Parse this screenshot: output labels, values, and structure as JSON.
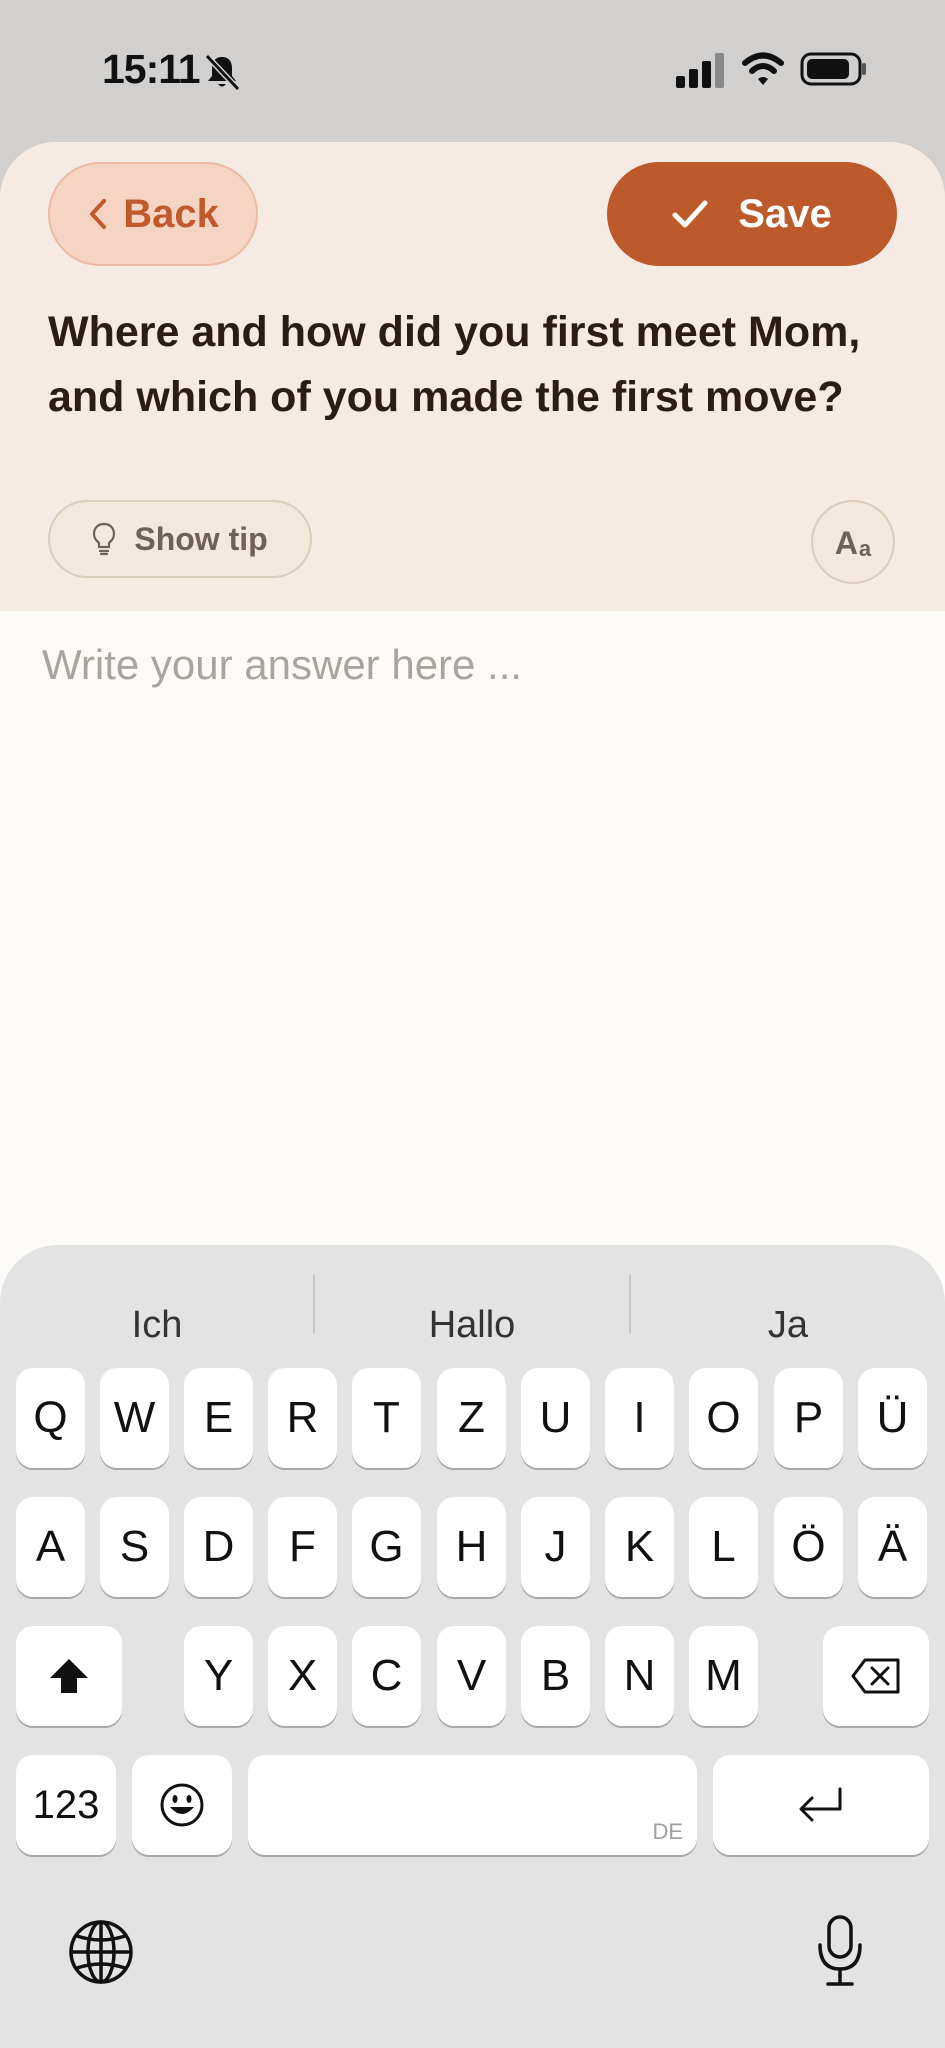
{
  "status_bar": {
    "time": "15:11",
    "icons": [
      "silent-bell-icon",
      "cellular-signal-icon",
      "wifi-icon",
      "battery-icon"
    ]
  },
  "header": {
    "back_label": "Back",
    "save_label": "Save",
    "question": "Where and how did you first meet Mom, and which of you made the first move?",
    "tip_label": "Show tip",
    "font_size_big": "A",
    "font_size_small": "a"
  },
  "answer": {
    "placeholder": "Write your answer here ...",
    "value": ""
  },
  "keyboard": {
    "suggestions": [
      "Ich",
      "Hallo",
      "Ja"
    ],
    "row1": [
      "Q",
      "W",
      "E",
      "R",
      "T",
      "Z",
      "U",
      "I",
      "O",
      "P",
      "Ü"
    ],
    "row2": [
      "A",
      "S",
      "D",
      "F",
      "G",
      "H",
      "J",
      "K",
      "L",
      "Ö",
      "Ä"
    ],
    "row3": [
      "Y",
      "X",
      "C",
      "V",
      "B",
      "N",
      "M"
    ],
    "numbers_label": "123",
    "space_language": "DE"
  },
  "colors": {
    "accent": "#bd5a2c",
    "back_bg": "#f6d4c3",
    "header_bg": "#f5ebe2",
    "answer_bg": "#fdfbf7"
  }
}
